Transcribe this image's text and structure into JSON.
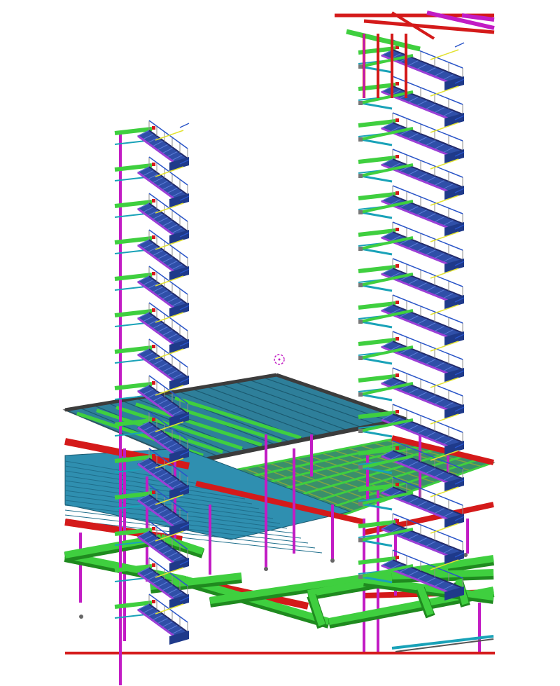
{
  "viewport": {
    "background": "#ffffff",
    "model": "structural-steel-3d-view"
  },
  "colors": {
    "stair_stringer": "#1f3a8a",
    "stair_tread": "#2f4fa8",
    "stair_edge": "#9b3fd6",
    "column": "#c21cc4",
    "beam_green": "#3fcf3f",
    "beam_green_dark": "#1f8a1f",
    "beam_red": "#d41a1a",
    "deck_teal": "#2e7f9a",
    "deck_teal_dark": "#1b5a70",
    "deck_edge": "#4a4a4a",
    "brace_cyan": "#19a2b8",
    "rail_yellow": "#e2e230",
    "rail_grey": "#8c8c8c",
    "rail_blue": "#2a55c8",
    "cursor_marker": "#c21cc4"
  },
  "stair_tower_left": {
    "landings": 14
  },
  "stair_tower_right": {
    "landings": 15
  },
  "cursor": {
    "icon": "snap-target-icon"
  }
}
